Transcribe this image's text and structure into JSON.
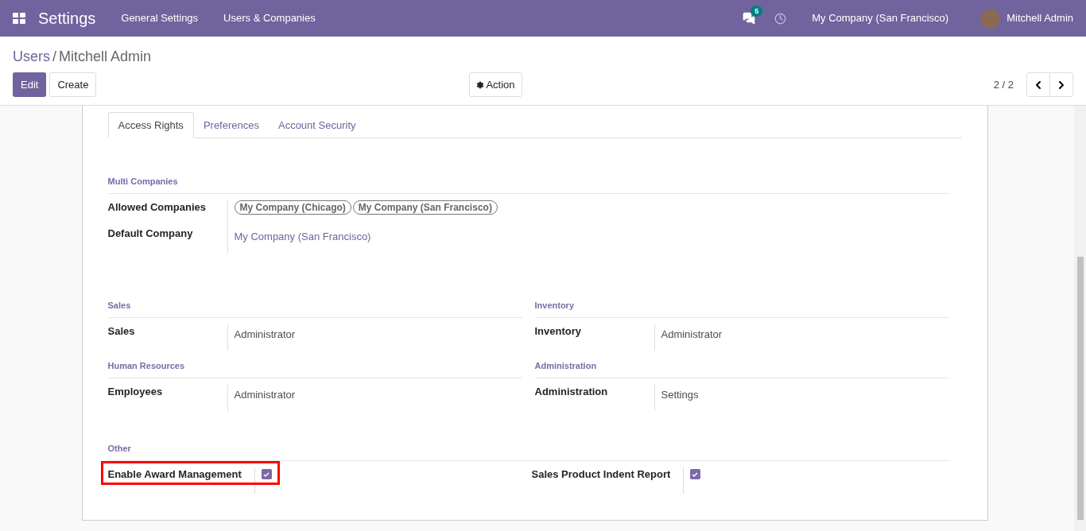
{
  "navbar": {
    "app_title": "Settings",
    "menus": [
      "General Settings",
      "Users & Companies"
    ],
    "messages_count": "5",
    "company": "My Company (San Francisco)",
    "user": "Mitchell Admin"
  },
  "breadcrumb": [
    "Users",
    "/",
    "Mitchell Admin"
  ],
  "buttons": {
    "edit": "Edit",
    "create": "Create",
    "action": "Action"
  },
  "pager": "2 / 2",
  "tabs": [
    {
      "label": "Access Rights",
      "selected": true
    },
    {
      "label": "Preferences",
      "selected": false
    },
    {
      "label": "Account Security",
      "selected": false
    }
  ],
  "multi_companies": {
    "title": "Multi Companies",
    "fields": [
      {
        "kind": "tags",
        "label": "Allowed Companies",
        "tags": [
          "My Company (Chicago)",
          "My Company (San Francisco)"
        ]
      },
      {
        "kind": "link",
        "label": "Default Company",
        "value": "My Company (San Francisco)"
      }
    ]
  },
  "groups": [
    {
      "title": "Sales",
      "fields": [
        {
          "kind": "text",
          "label": "Sales",
          "value": "Administrator"
        }
      ]
    },
    {
      "title": "Inventory",
      "fields": [
        {
          "kind": "text",
          "label": "Inventory",
          "value": "Administrator"
        }
      ]
    },
    {
      "title": "Human Resources",
      "fields": [
        {
          "kind": "text",
          "label": "Employees",
          "value": "Administrator"
        }
      ]
    },
    {
      "title": "Administration",
      "fields": [
        {
          "kind": "text",
          "label": "Administration",
          "value": "Settings"
        }
      ]
    }
  ],
  "other": {
    "title": "Other",
    "fields": [
      {
        "kind": "checkbox",
        "label": "Enable Award Management",
        "checked": true,
        "highlighted": true
      },
      {
        "kind": "checkbox",
        "label": "Sales Product Indent Report",
        "checked": true,
        "highlighted": false
      }
    ]
  }
}
